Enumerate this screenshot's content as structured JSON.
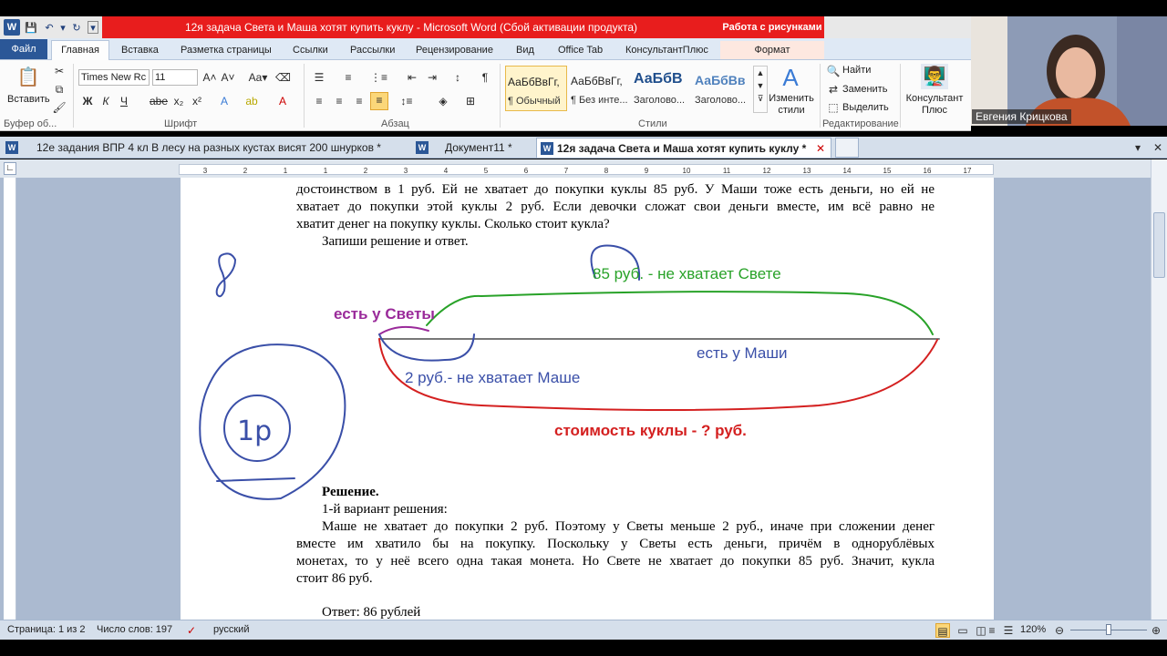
{
  "window": {
    "title": "12я задача Света и Маша хотят купить куклу  -  Microsoft Word (Сбой активации продукта)",
    "context_tab_header": "Работа с рисунками"
  },
  "ribbon_tabs": [
    "Файл",
    "Главная",
    "Вставка",
    "Разметка страницы",
    "Ссылки",
    "Рассылки",
    "Рецензирование",
    "Вид",
    "Office Tab",
    "КонсультантПлюс",
    "Формат"
  ],
  "clipboard": {
    "paste_label": "Вставить",
    "group_label": "Буфер об..."
  },
  "font": {
    "name": "Times New Rc",
    "size": "11",
    "group_label": "Шрифт"
  },
  "paragraph": {
    "group_label": "Абзац"
  },
  "styles": {
    "group_label": "Стили",
    "items": [
      {
        "preview": "АаБбВвГг,",
        "name": "¶ Обычный"
      },
      {
        "preview": "АаБбВвГг,",
        "name": "¶ Без инте..."
      },
      {
        "preview": "АаБбВ",
        "name": "Заголово..."
      },
      {
        "preview": "АаБбВв",
        "name": "Заголово..."
      }
    ],
    "change_styles": "Изменить стили"
  },
  "editing": {
    "find": "Найти",
    "replace": "Заменить",
    "select": "Выделить",
    "group_label": "Редактирование"
  },
  "consultant": {
    "label": "Консультант Плюс",
    "group_label": "КонсультантПлюс"
  },
  "doc_tabs": [
    {
      "label": "12е задания ВПР 4 кл В лесу на разных кустах висят 200 шнурков *"
    },
    {
      "label": "Документ11 *"
    },
    {
      "label": "12я задача Света и Маша хотят купить куклу *"
    }
  ],
  "ruler_numbers": [
    "3",
    "2",
    "1",
    "1",
    "2",
    "3",
    "4",
    "5",
    "6",
    "7",
    "8",
    "9",
    "10",
    "11",
    "12",
    "13",
    "14",
    "15",
    "16",
    "17"
  ],
  "document": {
    "lines_top": [
      "достоинством в 1 руб. Ей не хватает до покупки куклы 85 руб. У Маши тоже есть деньги, но ей не",
      "хватает до покупки этой куклы 2 руб. Если девочки сложат свои деньги вместе, им всё равно не",
      "хватит денег на покупку куклы. Сколько стоит кукла?"
    ],
    "task_prompt": "Запиши решение и ответ.",
    "diagram": {
      "sveta_missing": "85 руб. - не хватает Свете",
      "sveta_has": "есть у Светы",
      "masha_has": "есть у Маши",
      "masha_missing": "2 руб.- не хватает Маше",
      "doll_cost": "стоимость куклы - ? руб.",
      "handwritten_coin": "1р",
      "handwritten_eight": "8"
    },
    "solution_heading": "Решение.",
    "variant": "1-й вариант решения:",
    "solution_lines": [
      "Маше не хватает до покупки 2 руб. Поэтому у Светы меньше 2 руб., иначе при сложении денег",
      "вместе им хватило бы на покупку. Поскольку у Светы есть деньги, причём в однорублёвых",
      "монетах, то у неё всего одна такая монета. Но Свете не хватает до покупки 85 руб. Значит, кукла",
      "стоит 86 руб."
    ],
    "answer": "Ответ: 86 рублей"
  },
  "status": {
    "page": "Страница: 1 из 2",
    "words": "Число слов: 197",
    "language": "русский",
    "zoom": "120%"
  },
  "webcam": {
    "name": "Евгения Крицкова"
  },
  "colors": {
    "title_red": "#e81d1d",
    "green": "#28a228",
    "red": "#d42020",
    "blue": "#3a4fa8",
    "purple": "#9a2a9a"
  }
}
